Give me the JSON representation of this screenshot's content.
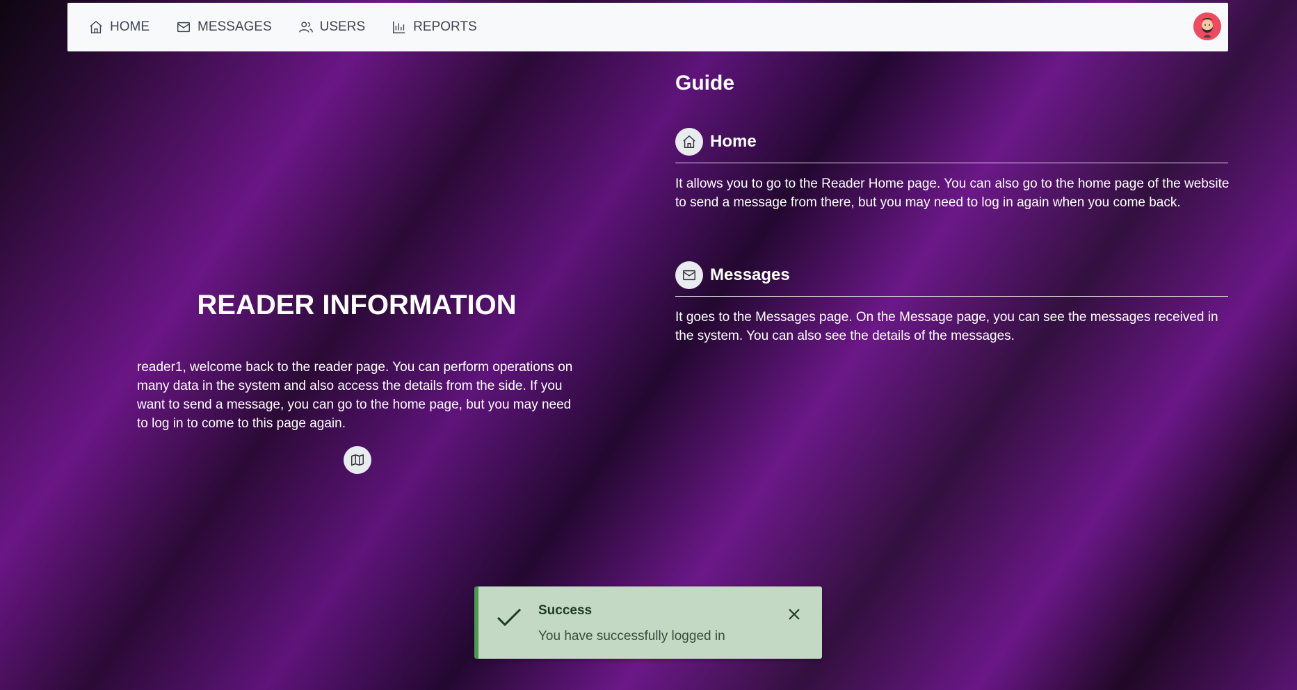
{
  "nav": {
    "items": [
      {
        "label": "HOME",
        "icon": "home-icon"
      },
      {
        "label": "MESSAGES",
        "icon": "envelope-icon"
      },
      {
        "label": "USERS",
        "icon": "users-icon"
      },
      {
        "label": "REPORTS",
        "icon": "bar-chart-icon"
      }
    ],
    "avatar_icon": "user-avatar"
  },
  "reader": {
    "title": "READER INFORMATION",
    "text": "reader1, welcome back to the reader page. You can perform operations on many data in the system and also access the details from the side. If you want to send a message, you can go to the home page, but you may need to log in to come to this page again.",
    "button_icon": "map-icon"
  },
  "guide": {
    "title": "Guide",
    "sections": [
      {
        "title": "Home",
        "icon": "home-icon",
        "text": "It allows you to go to the Reader Home page. You can also go to the home page of the website to send a message from there, but you may need to log in again when you come back."
      },
      {
        "title": "Messages",
        "icon": "envelope-icon",
        "text": "It goes to the Messages page. On the Message page, you can see the messages received in the system. You can also see the details of the messages."
      }
    ]
  },
  "toast": {
    "title": "Success",
    "message": "You have successfully logged in",
    "icon": "check-icon",
    "close_icon": "close-icon"
  },
  "colors": {
    "navbar_bg": "#f8f9fa",
    "toast_bg": "#c3d9c4",
    "toast_accent": "#4a9a4f",
    "background_purple": "#6a1685"
  }
}
